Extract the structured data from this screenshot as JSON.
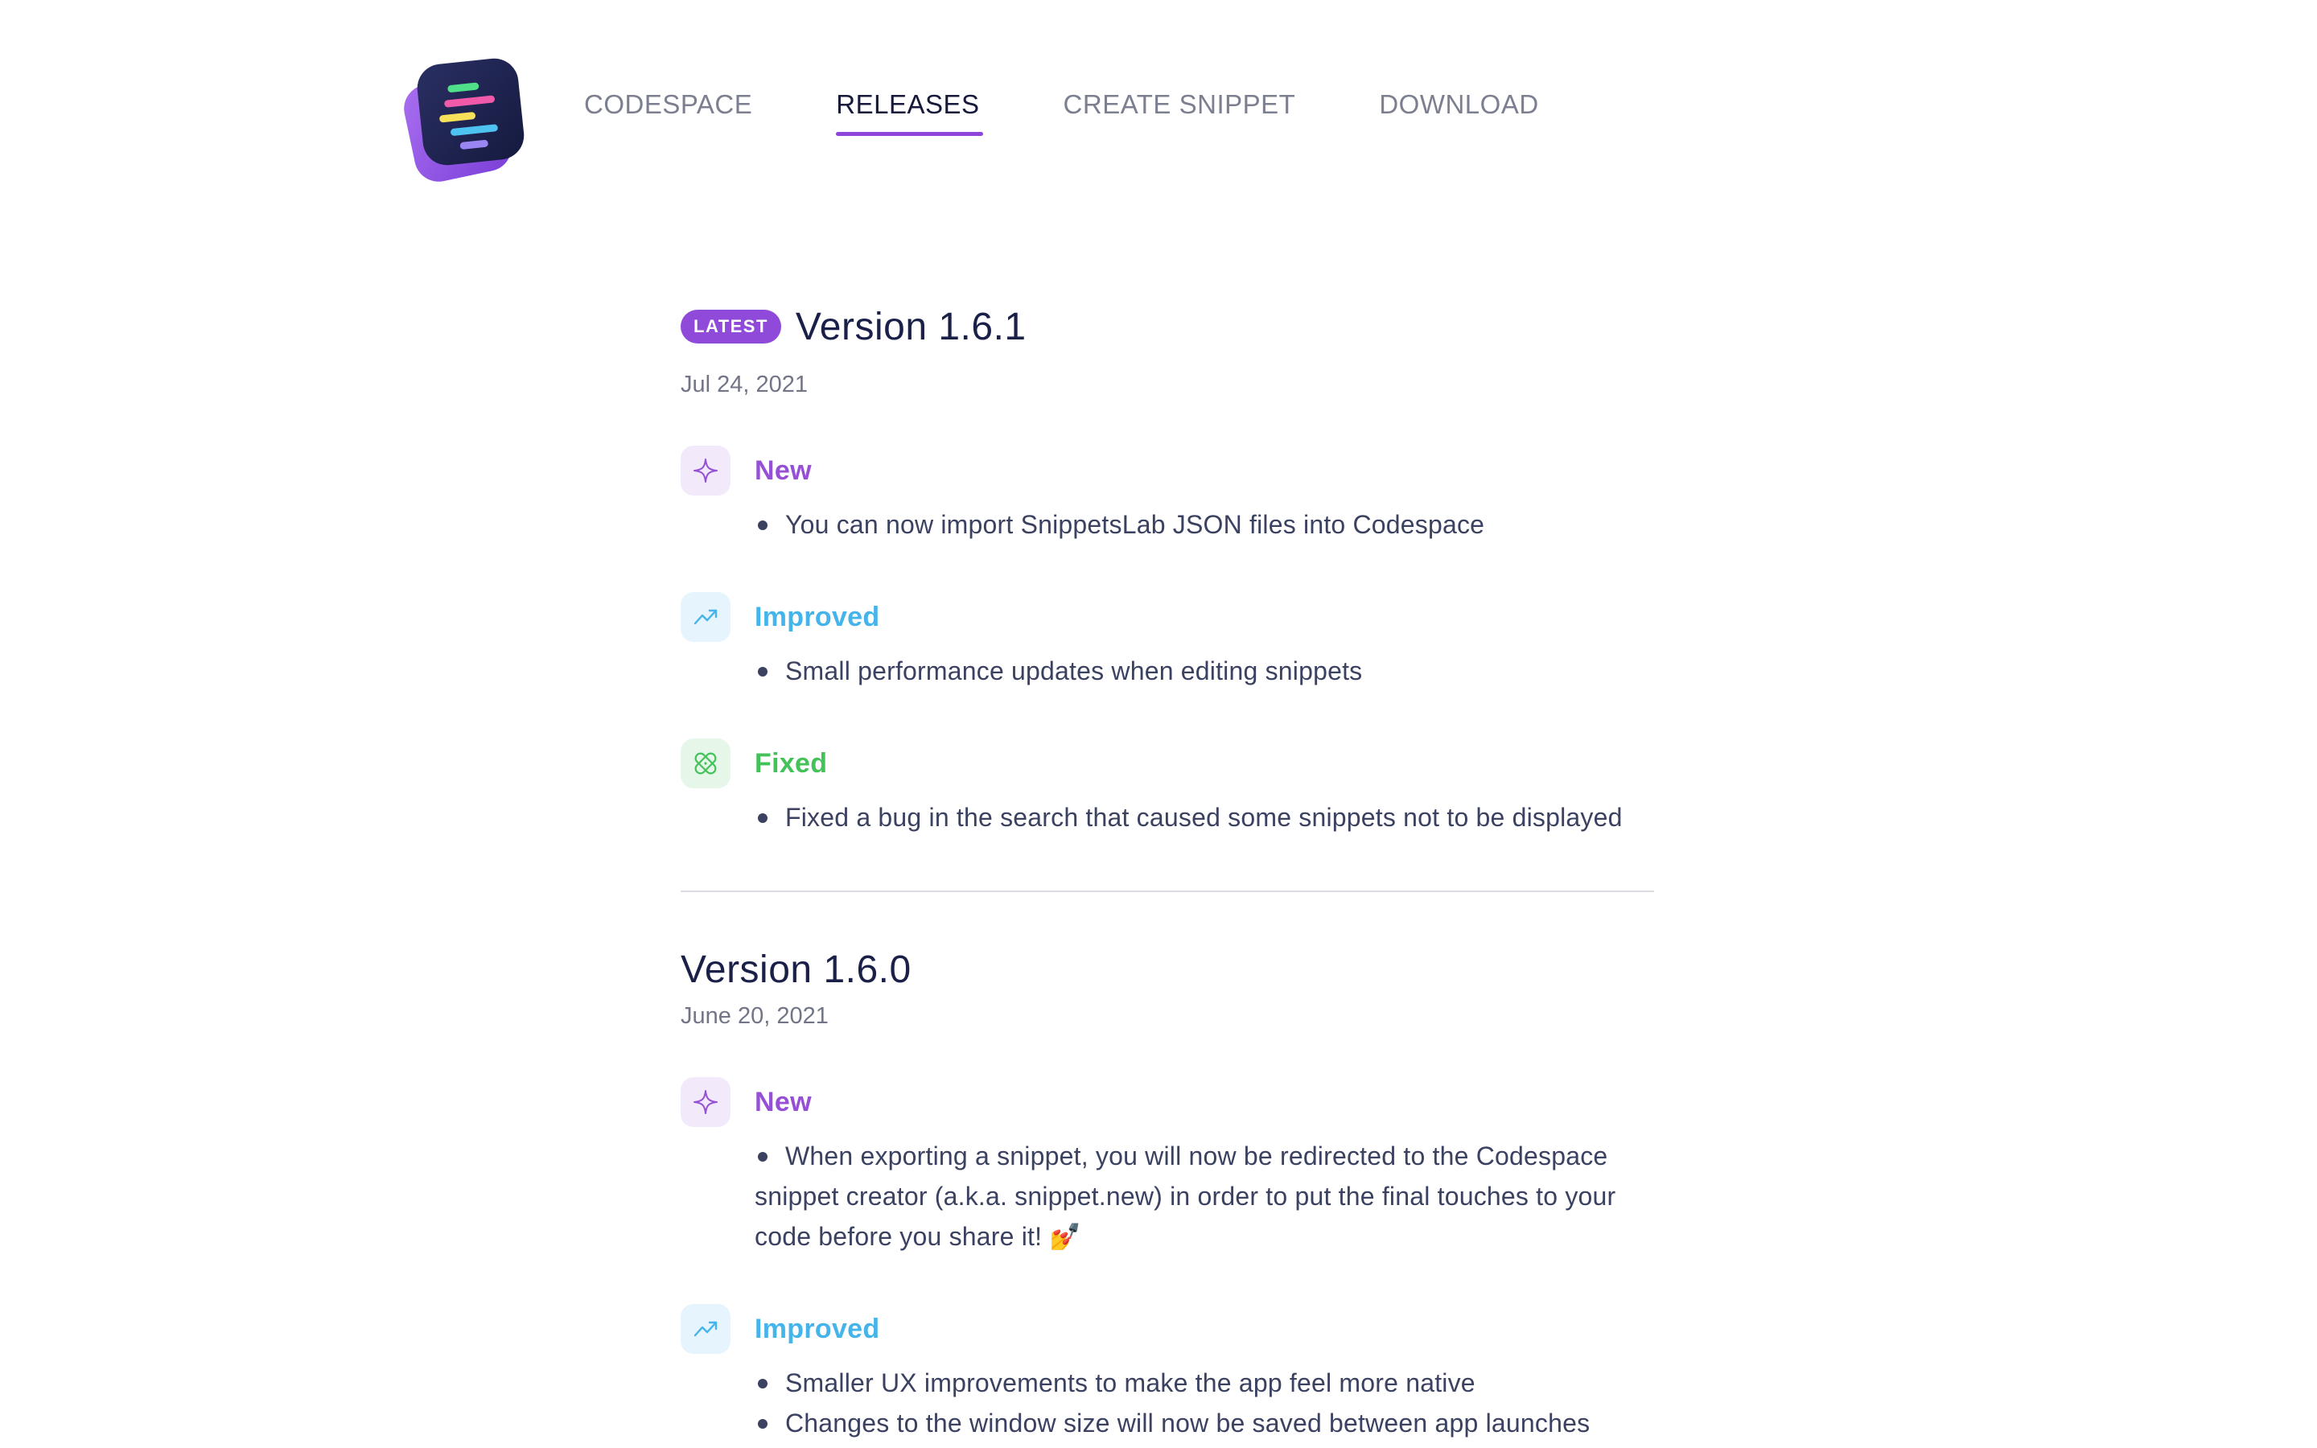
{
  "nav": {
    "items": [
      {
        "label": "CODESPACE",
        "active": false
      },
      {
        "label": "RELEASES",
        "active": true
      },
      {
        "label": "CREATE SNIPPET",
        "active": false
      },
      {
        "label": "DOWNLOAD",
        "active": false
      }
    ]
  },
  "colors": {
    "accent": "#8f45dc",
    "new": "#9650d6",
    "improved": "#45b4ea",
    "fixed": "#43c25a"
  },
  "releases": [
    {
      "badge": "LATEST",
      "version": "Version 1.6.1",
      "date": "Jul 24, 2021",
      "new_label": "New",
      "new_icon": "sparkle-icon",
      "new_items": [
        "You can now import SnippetsLab JSON files into Codespace"
      ],
      "improved_label": "Improved",
      "improved_icon": "trending-up-icon",
      "improved_items": [
        "Small performance updates when editing snippets"
      ],
      "fixed_label": "Fixed",
      "fixed_icon": "bandage-icon",
      "fixed_items": [
        "Fixed a bug in the search that caused some snippets not to be displayed"
      ]
    },
    {
      "version": "Version 1.6.0",
      "date": "June 20, 2021",
      "new_label": "New",
      "new_items": [
        "When exporting a snippet, you will now be redirected to the Codespace snippet creator (a.k.a. snippet.new) in order to put the final touches to your code before you share it! 💅"
      ],
      "improved_label": "Improved",
      "improved_items": [
        "Smaller UX improvements to make the app feel more native",
        "Changes to the window size will now be saved between app launches"
      ]
    }
  ]
}
